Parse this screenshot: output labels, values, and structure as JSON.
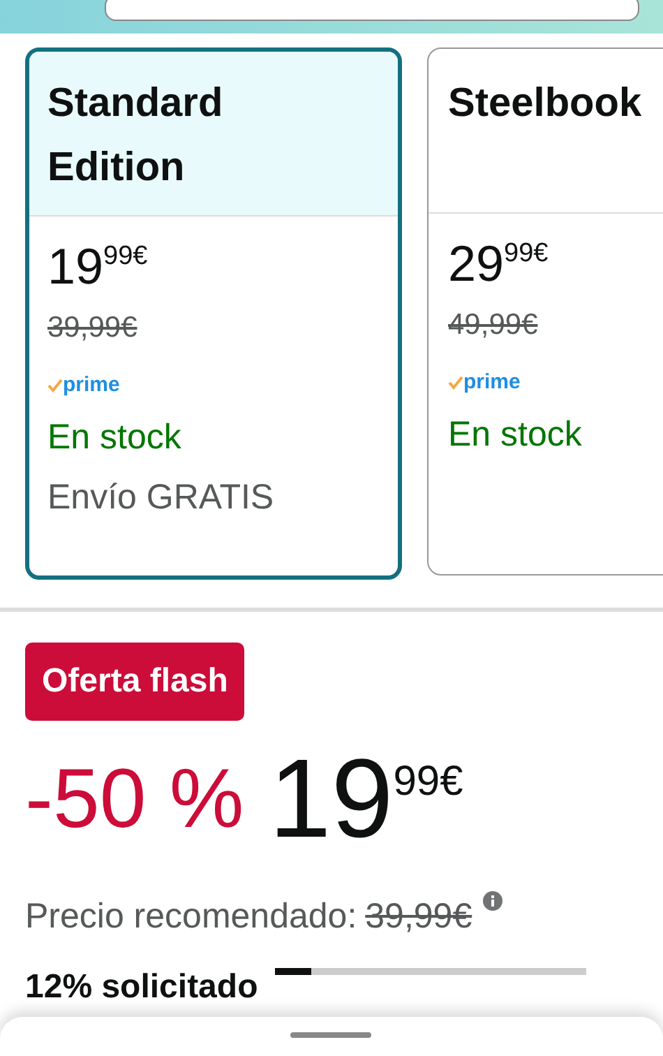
{
  "editions": [
    {
      "title": "Standard Edition",
      "selected": true,
      "price": {
        "whole": "19",
        "fraction": "99",
        "currency": "€"
      },
      "list_price": "39,99€",
      "prime": "prime",
      "availability": "En stock",
      "shipping": "Envío GRATIS"
    },
    {
      "title": "Steelbook",
      "selected": false,
      "price": {
        "whole": "29",
        "fraction": "99",
        "currency": "€"
      },
      "list_price": "49,99€",
      "prime": "prime",
      "availability": "En stock"
    }
  ],
  "deal": {
    "badge": "Oferta flash",
    "discount": "-50 %",
    "price": {
      "whole": "19",
      "fraction": "99",
      "currency": "€"
    },
    "rrp_label": "Precio recomendado:",
    "rrp_value": "39,99€",
    "claimed": "12% solicitado",
    "level": 0.12
  }
}
